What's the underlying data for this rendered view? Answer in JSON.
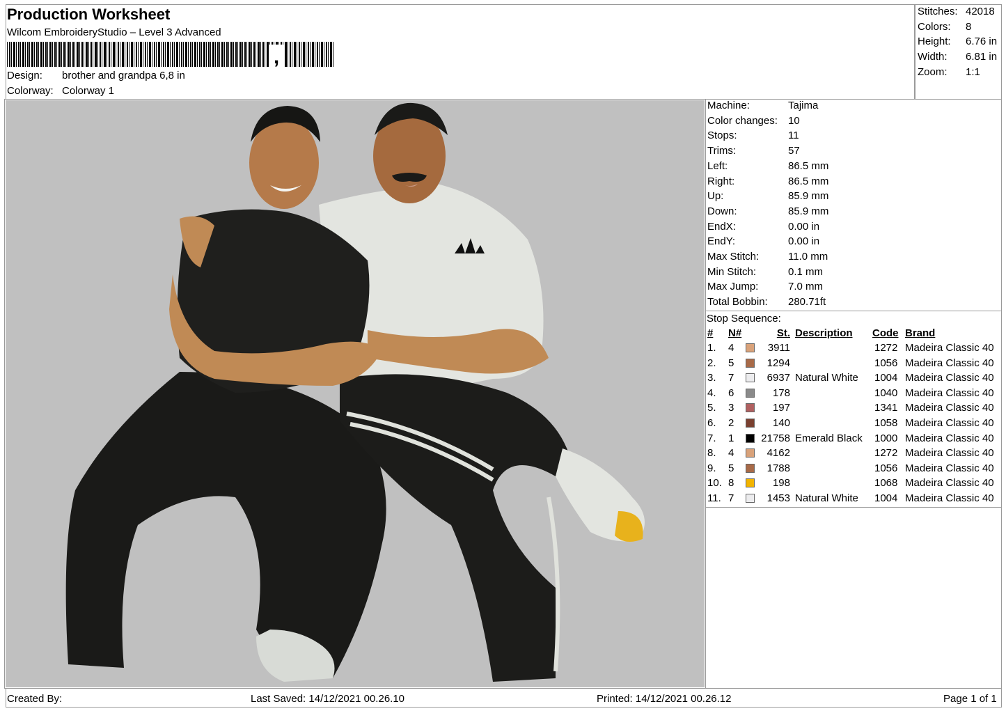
{
  "header": {
    "title": "Production Worksheet",
    "subtitle": "Wilcom EmbroideryStudio – Level 3 Advanced",
    "design_label": "Design:",
    "design_value": "brother and grandpa 6,8 in",
    "colorway_label": "Colorway:",
    "colorway_value": "Colorway 1"
  },
  "summary": [
    {
      "label": "Stitches:",
      "value": "42018"
    },
    {
      "label": "Colors:",
      "value": "8"
    },
    {
      "label": "Height:",
      "value": "6.76 in"
    },
    {
      "label": "Width:",
      "value": "6.81 in"
    },
    {
      "label": "Zoom:",
      "value": "1:1"
    }
  ],
  "machine_info": [
    {
      "label": "Machine:",
      "value": "Tajima"
    },
    {
      "label": "Color changes:",
      "value": "10"
    },
    {
      "label": "Stops:",
      "value": "11"
    },
    {
      "label": "Trims:",
      "value": "57"
    },
    {
      "label": "Left:",
      "value": "86.5 mm"
    },
    {
      "label": "Right:",
      "value": "86.5 mm"
    },
    {
      "label": "Up:",
      "value": "85.9 mm"
    },
    {
      "label": "Down:",
      "value": "85.9 mm"
    },
    {
      "label": "EndX:",
      "value": "0.00 in"
    },
    {
      "label": "EndY:",
      "value": "0.00 in"
    },
    {
      "label": "Max Stitch:",
      "value": "11.0 mm"
    },
    {
      "label": "Min Stitch:",
      "value": "0.1 mm"
    },
    {
      "label": "Max Jump:",
      "value": "7.0 mm"
    },
    {
      "label": "Total Bobbin:",
      "value": "280.71ft"
    }
  ],
  "stop_sequence": {
    "title": "Stop Sequence:",
    "columns": [
      "#",
      "N#",
      "St.",
      "Description",
      "Code",
      "Brand"
    ],
    "rows": [
      {
        "num": "1.",
        "n": "4",
        "color": "#d9a27a",
        "st": "3911",
        "desc": "",
        "code": "1272",
        "brand": "Madeira Classic 40"
      },
      {
        "num": "2.",
        "n": "5",
        "color": "#a86a48",
        "st": "1294",
        "desc": "",
        "code": "1056",
        "brand": "Madeira Classic 40"
      },
      {
        "num": "3.",
        "n": "7",
        "color": "#ececee",
        "st": "6937",
        "desc": "Natural White",
        "code": "1004",
        "brand": "Madeira Classic 40"
      },
      {
        "num": "4.",
        "n": "6",
        "color": "#8a8a8a",
        "st": "178",
        "desc": "",
        "code": "1040",
        "brand": "Madeira Classic 40"
      },
      {
        "num": "5.",
        "n": "3",
        "color": "#b06060",
        "st": "197",
        "desc": "",
        "code": "1341",
        "brand": "Madeira Classic 40"
      },
      {
        "num": "6.",
        "n": "2",
        "color": "#7a4030",
        "st": "140",
        "desc": "",
        "code": "1058",
        "brand": "Madeira Classic 40"
      },
      {
        "num": "7.",
        "n": "1",
        "color": "#000000",
        "st": "21758",
        "desc": "Emerald Black",
        "code": "1000",
        "brand": "Madeira Classic 40"
      },
      {
        "num": "8.",
        "n": "4",
        "color": "#d9a27a",
        "st": "4162",
        "desc": "",
        "code": "1272",
        "brand": "Madeira Classic 40"
      },
      {
        "num": "9.",
        "n": "5",
        "color": "#a86a48",
        "st": "1788",
        "desc": "",
        "code": "1056",
        "brand": "Madeira Classic 40"
      },
      {
        "num": "10.",
        "n": "8",
        "color": "#f2b400",
        "st": "198",
        "desc": "",
        "code": "1068",
        "brand": "Madeira Classic 40"
      },
      {
        "num": "11.",
        "n": "7",
        "color": "#ececee",
        "st": "1453",
        "desc": "Natural White",
        "code": "1004",
        "brand": "Madeira Classic 40"
      }
    ]
  },
  "footer": {
    "created_by": "Created By:",
    "last_saved": "Last Saved: 14/12/2021 00.26.10",
    "printed": "Printed: 14/12/2021 00.26.12",
    "page": "Page 1 of 1"
  }
}
